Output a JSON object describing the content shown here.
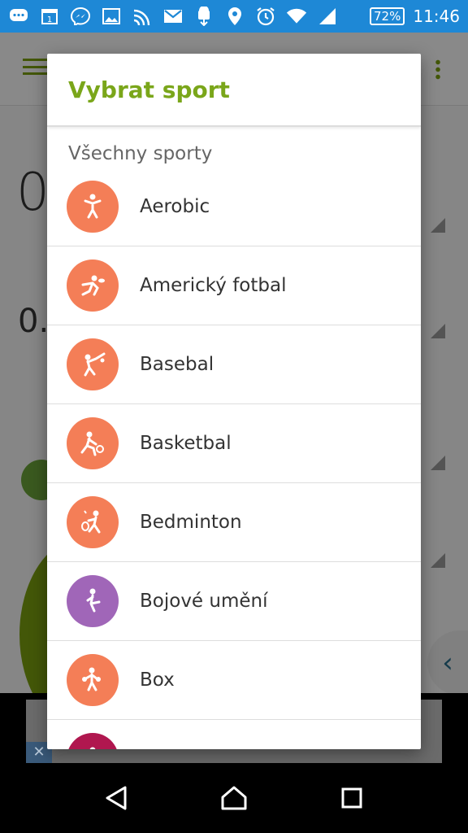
{
  "status_bar": {
    "battery": "72%",
    "time": "11:46",
    "icons": [
      "chat-icon",
      "calendar-icon",
      "messenger-icon",
      "gallery-icon",
      "wifi-signal-icon",
      "gmail-icon",
      "android-download-icon",
      "location-icon",
      "alarm-icon",
      "wifi-icon",
      "cell-signal-icon"
    ]
  },
  "background": {
    "big_number": "0",
    "small_number": "0."
  },
  "dialog": {
    "title": "Vybrat sport",
    "section": "Všechny sporty",
    "items": [
      {
        "label": "Aerobic",
        "icon": "aerobic-icon",
        "color": "#f47e57"
      },
      {
        "label": "Americký fotbal",
        "icon": "american-football-icon",
        "color": "#f47e57"
      },
      {
        "label": "Basebal",
        "icon": "baseball-icon",
        "color": "#f47e57"
      },
      {
        "label": "Basketbal",
        "icon": "basketball-icon",
        "color": "#f47e57"
      },
      {
        "label": "Bedminton",
        "icon": "badminton-icon",
        "color": "#f47e57"
      },
      {
        "label": "Bojové umění",
        "icon": "martial-arts-icon",
        "color": "#a066b8"
      },
      {
        "label": "Box",
        "icon": "boxing-icon",
        "color": "#f47e57"
      },
      {
        "label": "",
        "icon": "sport-icon",
        "color": "#b0174f"
      }
    ]
  },
  "colors": {
    "accent": "#7aa61a",
    "status_bar": "#1e88d6"
  }
}
